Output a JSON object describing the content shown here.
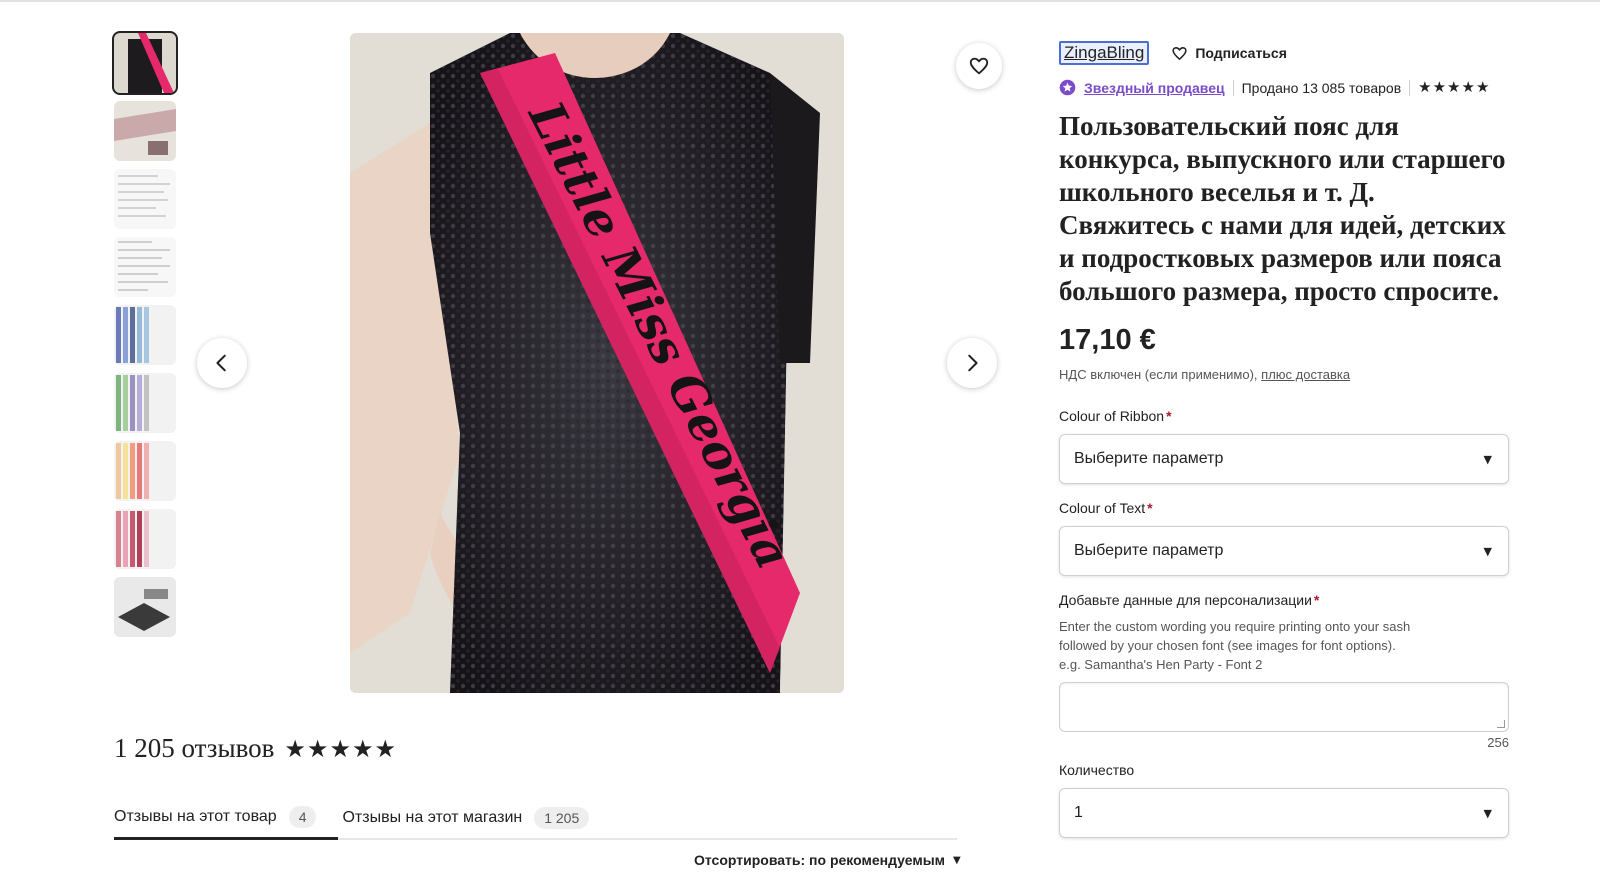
{
  "shop": {
    "name": "ZingaBling",
    "follow_label": "Подписаться",
    "star_seller_label": "Звездный продавец",
    "sales_text": "Продано 13 085 товаров",
    "rating_stars": 5
  },
  "product": {
    "title": "Пользовательский пояс для конкурса, выпускного или старшего школьного веселья и т. Д. Свяжитесь с нами для идей, детских и подростковых размеров или пояса большого размера, просто спросите.",
    "price": "17,10 €",
    "vat_text": "НДС включен (если применимо),",
    "shipping_link": "плюс доставка",
    "sash_text": "Little Miss Georgia"
  },
  "options": {
    "ribbon_label": "Colour of Ribbon",
    "ribbon_value": "Выберите параметр",
    "text_label": "Colour of Text",
    "text_value": "Выберите параметр",
    "personalization_label": "Добавьте данные для персонализации",
    "personalization_help": [
      "Enter the custom wording you require printing onto your sash",
      "followed by your chosen font (see images for font options).",
      "e.g. Samantha's Hen Party - Font 2"
    ],
    "char_counter": "256",
    "quantity_label": "Количество",
    "quantity_value": "1",
    "required_mark": "*"
  },
  "reviews": {
    "count_text": "1 205 отзывов",
    "rating_stars": 5,
    "tabs": [
      {
        "label": "Отзывы на этот товар",
        "count": "4",
        "active": true
      },
      {
        "label": "Отзывы на этот магазин",
        "count": "1 205",
        "active": false
      }
    ],
    "sort_label": "Отсортировать: по рекомендуемым"
  },
  "gallery": {
    "thumbnail_count": 9,
    "active_index": 0
  },
  "icons": {
    "prev": "chevron-left-icon",
    "next": "chevron-right-icon",
    "favorite": "heart-icon",
    "follow": "heart-icon",
    "star_seller": "star-seller-badge-icon",
    "star": "star-icon",
    "dropdown": "caret-down-icon"
  },
  "colors": {
    "accent_purple": "#7b4cc9",
    "required_red": "#a61a2e",
    "sash_pink": "#e5296b"
  }
}
